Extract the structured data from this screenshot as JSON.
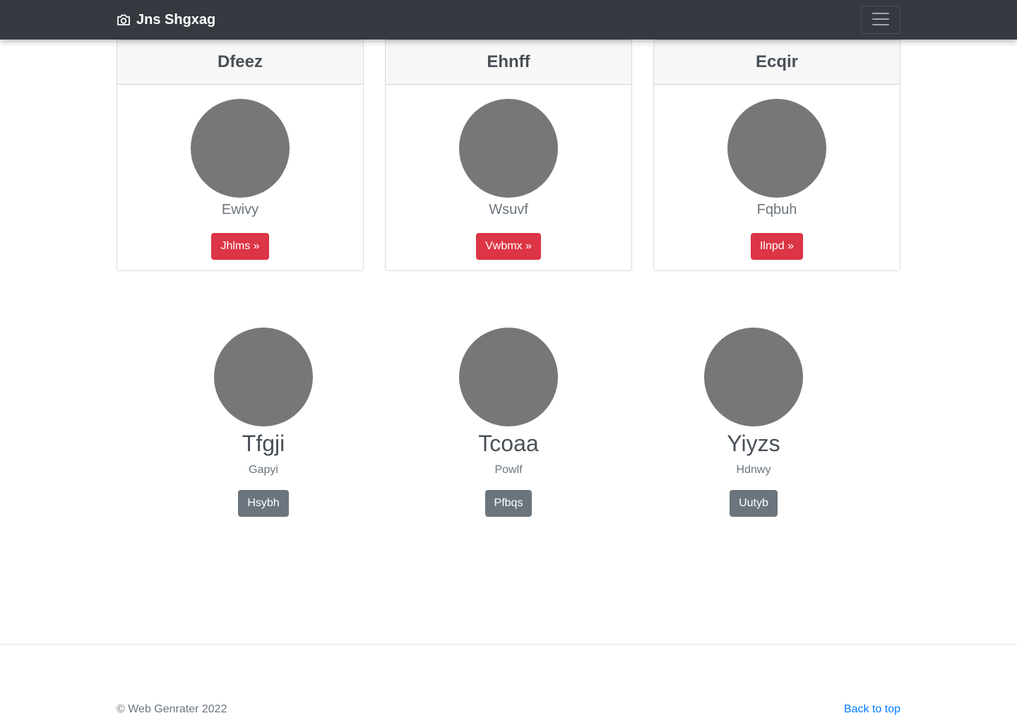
{
  "navbar": {
    "brand_icon": "camera-icon",
    "brand_label": "Jns Shgxag",
    "toggler_icon": "hamburger-menu-icon"
  },
  "cards": [
    {
      "title": "Dfeez",
      "subtitle": "Ewivy",
      "button_label": "Jhlms »"
    },
    {
      "title": "Ehnff",
      "subtitle": "Wsuvf",
      "button_label": "Vwbmx »"
    },
    {
      "title": "Ecqir",
      "subtitle": "Fqbuh",
      "button_label": "Ilnpd »"
    }
  ],
  "people": [
    {
      "name": "Tfgji",
      "role": "Gapyi",
      "button_label": "Hsybh"
    },
    {
      "name": "Tcoaa",
      "role": "Powlf",
      "button_label": "Pfbqs"
    },
    {
      "name": "Yiyzs",
      "role": "Hdnwy",
      "button_label": "Uutyb"
    }
  ],
  "footer": {
    "copyright": "© Web Genrater 2022",
    "back_to_top": "Back to top"
  },
  "colors": {
    "navbar_bg": "#343a40",
    "danger": "#dc3545",
    "secondary": "#6c757d",
    "link": "#007bff",
    "avatar": "#777777"
  }
}
